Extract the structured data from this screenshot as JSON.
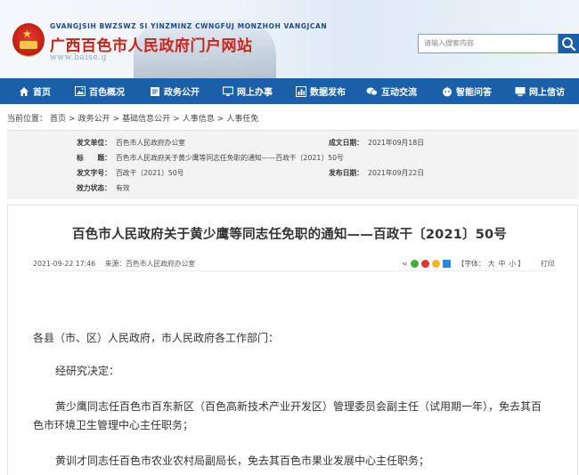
{
  "header": {
    "pinyin": "GVANGJSIH BWZSWZ  SI  YINZMINZ  CWNGFUJ  MONZHOH  VANGJCAN",
    "title": "广西百色市人民政府门户网站",
    "url": "www.baise.g",
    "search_placeholder": "请输入搜索内容"
  },
  "nav": {
    "items": [
      {
        "label": "首页",
        "icon": "home-icon"
      },
      {
        "label": "百色概况",
        "icon": "image-icon"
      },
      {
        "label": "政务公开",
        "icon": "document-icon"
      },
      {
        "label": "网上办事",
        "icon": "monitor-icon"
      },
      {
        "label": "数据发布",
        "icon": "chart-icon"
      },
      {
        "label": "互动交流",
        "icon": "chat-icon"
      },
      {
        "label": "智能问答",
        "icon": "robot-icon"
      },
      {
        "label": "网上信访",
        "icon": "computer-icon"
      }
    ]
  },
  "breadcrumb": {
    "prefix": "当前位置：",
    "items": [
      "首页",
      "政务公开",
      "基础信息公开",
      "人事信息",
      "人事任免"
    ],
    "separator": ">"
  },
  "meta": {
    "publisher_label": "发文单位：",
    "publisher": "百色市人民政府办公室",
    "written_label": "成文日期：",
    "written": "2021年09月18日",
    "title_label": "标　　题：",
    "title": "百色市人民政府关于黄少鹰等同志任免职的通知——百政干〔2021〕50号",
    "doc_no_label": "发文字号：",
    "doc_no": "百政干〔2021〕50号",
    "publish_label": "发布日期：",
    "publish": "2021年09月22日",
    "status_label": "效力状态：",
    "status": "有效"
  },
  "article": {
    "title": "百色市人民政府关于黄少鹰等同志任免职的通知——百政干〔2021〕50号",
    "datetime": "2021-09-22 17:46",
    "source_label": "来源：",
    "source": "百色市人民政府办公室",
    "font_size_label": "【字体：",
    "font_sizes": [
      "大",
      "中",
      "小"
    ],
    "font_size_close": "】",
    "print": "打印",
    "paragraphs": [
      "各县（市、区）人民政府，市人民政府各工作部门：",
      "经研究决定：",
      "黄少鹰同志任百色市百东新区（百色高新技术产业开发区）管理委员会副主任（试用期一年），免去其百",
      "色市环境卫生管理中心主任职务；",
      "黄训才同志任百色市农业农村局副局长，免去其百色市果业发展中心主任职务；"
    ]
  },
  "colors": {
    "nav_bg": "#1a5fa8",
    "title_red": "#c9241a",
    "meta_bg": "#f3f3f3"
  }
}
